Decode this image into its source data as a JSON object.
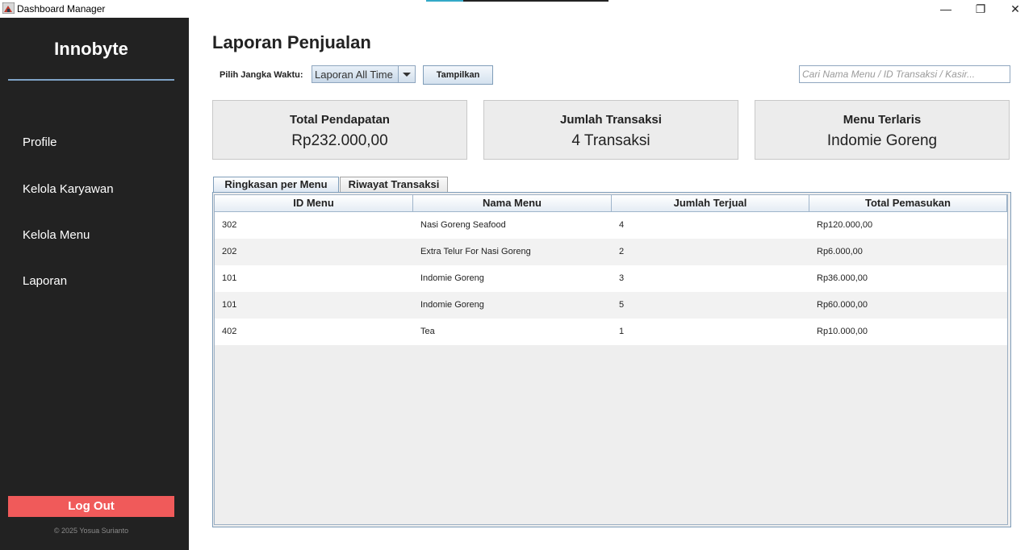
{
  "window": {
    "title": "Dashboard Manager",
    "minimize_glyph": "—",
    "restore_glyph": "❐",
    "close_glyph": "✕"
  },
  "sidebar": {
    "brand": "Innobyte",
    "items": [
      {
        "label": "Profile"
      },
      {
        "label": "Kelola Karyawan"
      },
      {
        "label": "Kelola Menu"
      },
      {
        "label": "Laporan"
      }
    ],
    "logout_label": "Log Out",
    "copyright": "© 2025 Yosua Surianto"
  },
  "main": {
    "title": "Laporan Penjualan",
    "range_label": "Pilih Jangka Waktu:",
    "range_value": "Laporan All Time",
    "show_button": "Tampilkan",
    "search_placeholder": "Cari Nama Menu / ID Transaksi / Kasir...",
    "cards": [
      {
        "title": "Total Pendapatan",
        "value": "Rp232.000,00"
      },
      {
        "title": "Jumlah Transaksi",
        "value": "4 Transaksi"
      },
      {
        "title": "Menu Terlaris",
        "value": "Indomie Goreng"
      }
    ],
    "tabs": [
      {
        "label": "Ringkasan per Menu",
        "active": true
      },
      {
        "label": "Riwayat Transaksi",
        "active": false
      }
    ],
    "table": {
      "columns": [
        "ID Menu",
        "Nama Menu",
        "Jumlah Terjual",
        "Total Pemasukan"
      ],
      "rows": [
        [
          "302",
          "Nasi Goreng Seafood",
          "4",
          "Rp120.000,00"
        ],
        [
          "202",
          "Extra Telur For Nasi Goreng",
          "2",
          "Rp6.000,00"
        ],
        [
          "101",
          "Indomie Goreng",
          "3",
          "Rp36.000,00"
        ],
        [
          "101",
          "Indomie Goreng",
          "5",
          "Rp60.000,00"
        ],
        [
          "402",
          "Tea",
          "1",
          "Rp10.000,00"
        ]
      ]
    }
  },
  "colors": {
    "sidebar_bg": "#222222",
    "logout_bg": "#f05a5a",
    "brand_underline": "#7fa3c7"
  }
}
